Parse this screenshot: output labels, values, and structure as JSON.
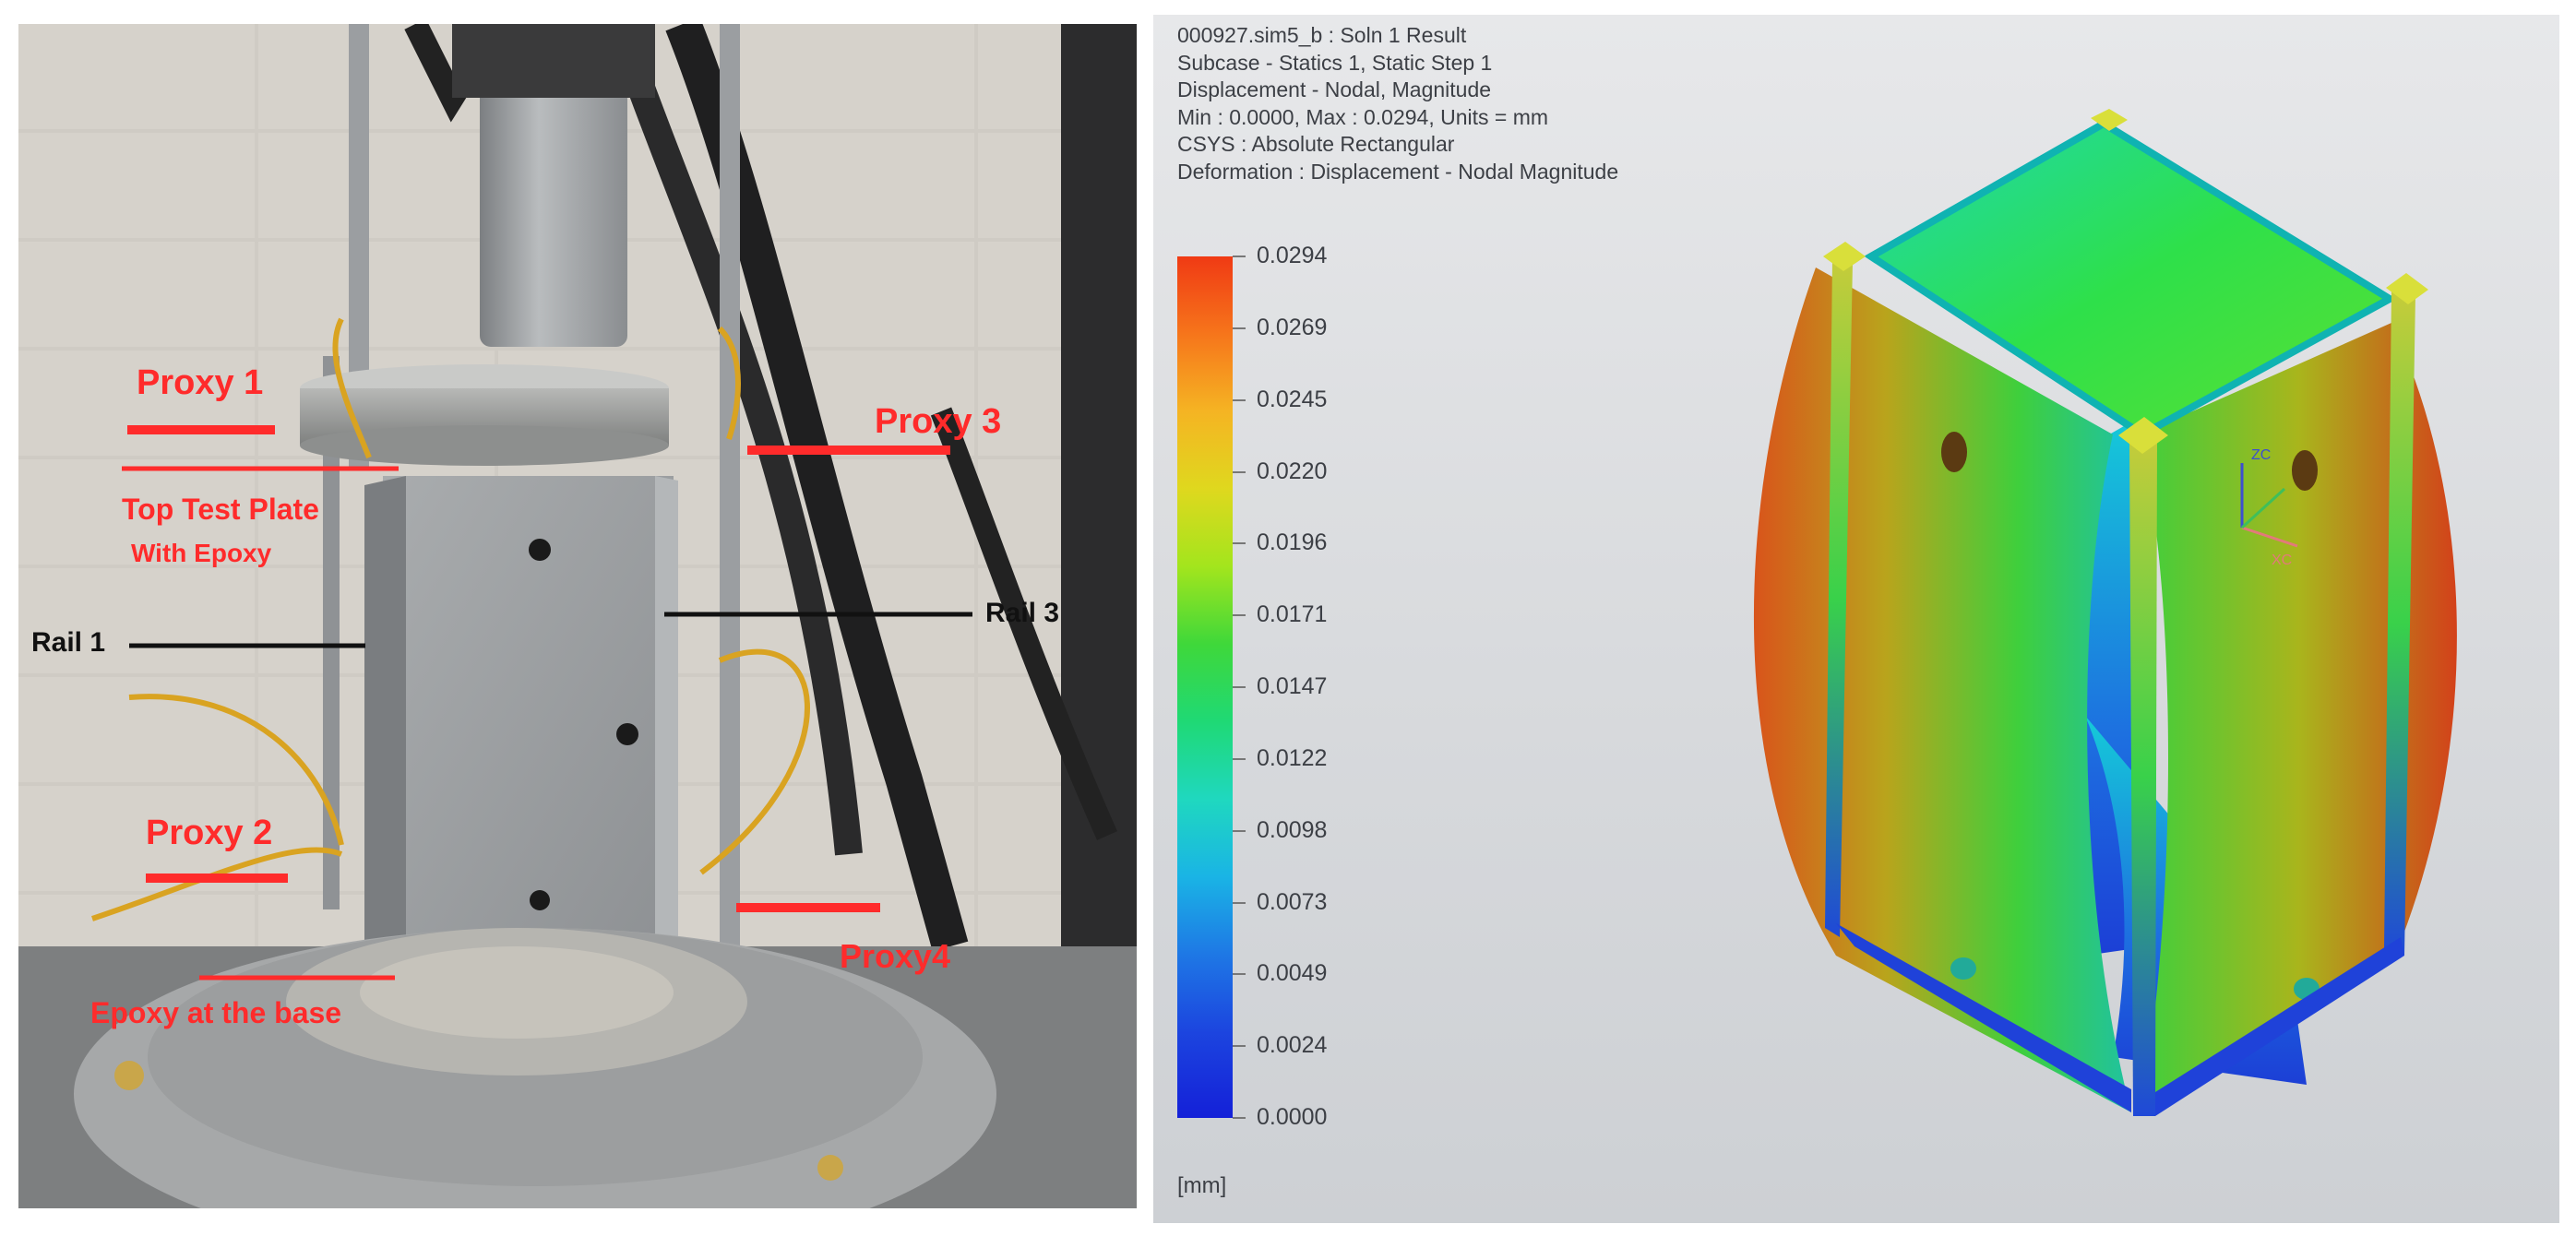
{
  "photo": {
    "labels": {
      "proxy1": "Proxy 1",
      "proxy2": "Proxy 2",
      "proxy3": "Proxy 3",
      "proxy4": "Proxy4",
      "top_plate_line1": "Top Test Plate",
      "top_plate_line2": "With Epoxy",
      "rail1": "Rail 1",
      "rail3": "Rail 3",
      "epoxy_base": "Epoxy at the base"
    },
    "colors": {
      "annotation_red": "#ff2b2b",
      "annotation_black": "#111111"
    }
  },
  "fea": {
    "header": [
      "000927.sim5_b : Soln 1 Result",
      "Subcase - Statics 1, Static Step 1",
      "Displacement - Nodal, Magnitude",
      "Min : 0.0000, Max : 0.0294, Units = mm",
      "CSYS : Absolute Rectangular",
      "Deformation : Displacement - Nodal Magnitude"
    ],
    "legend": {
      "values": [
        "0.0294",
        "0.0269",
        "0.0245",
        "0.0220",
        "0.0196",
        "0.0171",
        "0.0147",
        "0.0122",
        "0.0098",
        "0.0073",
        "0.0049",
        "0.0024",
        "0.0000"
      ],
      "unit": "[mm]",
      "colors": [
        "#f03a14",
        "#f6751b",
        "#f5b423",
        "#dfd81e",
        "#a3e51d",
        "#3fd83a",
        "#1fd975",
        "#1fd8bf",
        "#1ab4e5",
        "#1e78e5",
        "#1c45df",
        "#1420d8"
      ]
    },
    "triad": {
      "zc": "ZC",
      "xc": "XC"
    }
  }
}
